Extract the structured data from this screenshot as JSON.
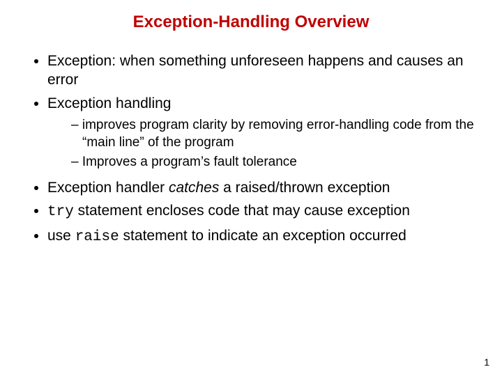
{
  "title": "Exception-Handling Overview",
  "b1": "Exception: when something unforeseen happens and causes an error",
  "b2": "Exception handling",
  "b2s1": "improves program clarity by removing error-handling code from the “main line” of the program",
  "b2s2": "Improves a program’s fault tolerance",
  "b3_a": "Exception handler ",
  "b3_i": "catches",
  "b3_b": " a raised/thrown exception",
  "b4_code": "try",
  "b4_rest": " statement encloses code that may cause exception",
  "b5_a": "use ",
  "b5_code": "raise",
  "b5_b": " statement to indicate an exception occurred",
  "pagenum": "1"
}
